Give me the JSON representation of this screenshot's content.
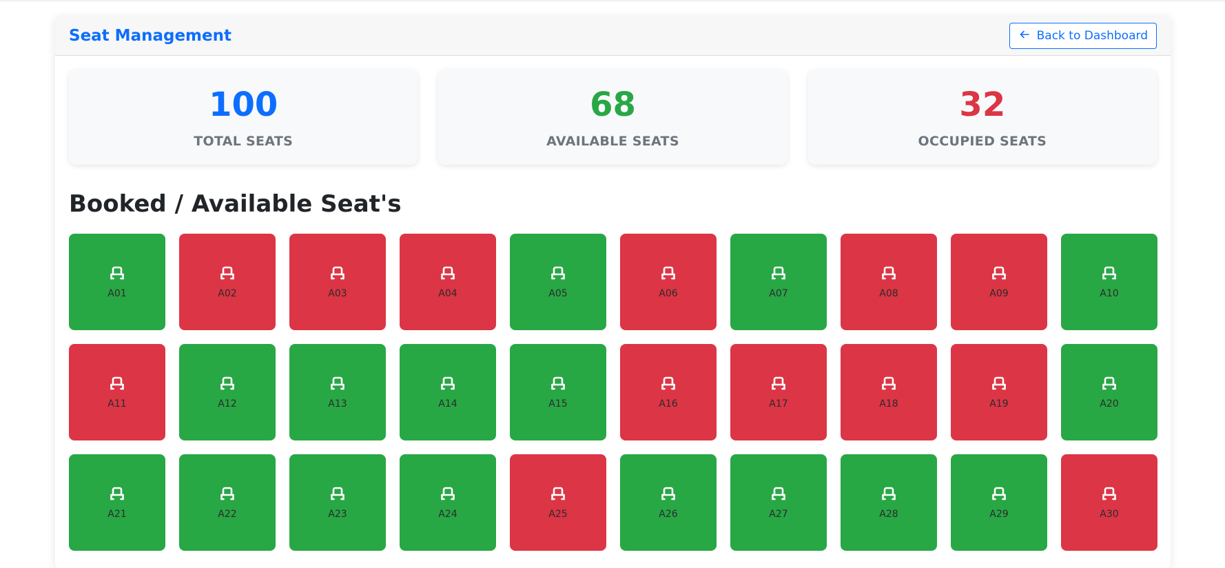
{
  "header": {
    "title": "Seat Management",
    "back_label": "Back to Dashboard"
  },
  "stats": {
    "total": {
      "value": "100",
      "label": "TOTAL SEATS",
      "color": "#0d6efd"
    },
    "available": {
      "value": "68",
      "label": "AVAILABLE SEATS",
      "color": "#28a745"
    },
    "occupied": {
      "value": "32",
      "label": "OCCUPIED SEATS",
      "color": "#dc3545"
    }
  },
  "section_title": "Booked / Available Seat's",
  "colors": {
    "available": "#28a745",
    "occupied": "#dc3545",
    "accent": "#0d6efd"
  },
  "seat_icon": "seat-icon",
  "seats": [
    {
      "label": "A01",
      "status": "available"
    },
    {
      "label": "A02",
      "status": "occupied"
    },
    {
      "label": "A03",
      "status": "occupied"
    },
    {
      "label": "A04",
      "status": "occupied"
    },
    {
      "label": "A05",
      "status": "available"
    },
    {
      "label": "A06",
      "status": "occupied"
    },
    {
      "label": "A07",
      "status": "available"
    },
    {
      "label": "A08",
      "status": "occupied"
    },
    {
      "label": "A09",
      "status": "occupied"
    },
    {
      "label": "A10",
      "status": "available"
    },
    {
      "label": "A11",
      "status": "occupied"
    },
    {
      "label": "A12",
      "status": "available"
    },
    {
      "label": "A13",
      "status": "available"
    },
    {
      "label": "A14",
      "status": "available"
    },
    {
      "label": "A15",
      "status": "available"
    },
    {
      "label": "A16",
      "status": "occupied"
    },
    {
      "label": "A17",
      "status": "occupied"
    },
    {
      "label": "A18",
      "status": "occupied"
    },
    {
      "label": "A19",
      "status": "occupied"
    },
    {
      "label": "A20",
      "status": "available"
    },
    {
      "label": "A21",
      "status": "available"
    },
    {
      "label": "A22",
      "status": "available"
    },
    {
      "label": "A23",
      "status": "available"
    },
    {
      "label": "A24",
      "status": "available"
    },
    {
      "label": "A25",
      "status": "occupied"
    },
    {
      "label": "A26",
      "status": "available"
    },
    {
      "label": "A27",
      "status": "available"
    },
    {
      "label": "A28",
      "status": "available"
    },
    {
      "label": "A29",
      "status": "available"
    },
    {
      "label": "A30",
      "status": "occupied"
    }
  ]
}
